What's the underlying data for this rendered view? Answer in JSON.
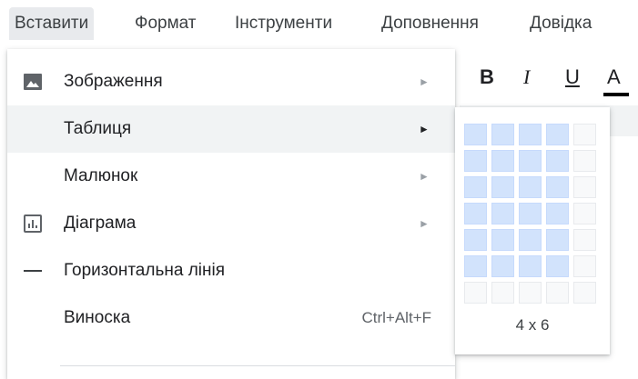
{
  "menubar": {
    "items": [
      {
        "label": "Вставити",
        "active": true
      },
      {
        "label": "Формат"
      },
      {
        "label": "Інструменти"
      },
      {
        "label": "Доповнення"
      },
      {
        "label": "Довідка"
      }
    ]
  },
  "toolbar": {
    "bold": "B",
    "italic": "I",
    "underline": "U",
    "text_color": "A"
  },
  "insert_menu": {
    "items": [
      {
        "label": "Зображення",
        "icon": "image-icon",
        "submenu": true
      },
      {
        "label": "Таблиця",
        "submenu": true,
        "highlighted": true
      },
      {
        "label": "Малюнок",
        "submenu": true
      },
      {
        "label": "Діаграма",
        "icon": "chart-icon",
        "submenu": true
      },
      {
        "label": "Горизонтальна лінія",
        "icon": "horizontal-line-icon"
      },
      {
        "label": "Виноска",
        "shortcut": "Ctrl+Alt+F"
      }
    ],
    "arrow_glyph": "►"
  },
  "table_picker": {
    "columns_selected": 4,
    "rows_selected": 6,
    "grid_columns": 5,
    "grid_rows": 7,
    "size_label": "4 x 6"
  },
  "colors": {
    "menu_hover": "#f1f3f4",
    "active_menu": "#e8eaed",
    "selected_cell": "#d2e3fc"
  }
}
